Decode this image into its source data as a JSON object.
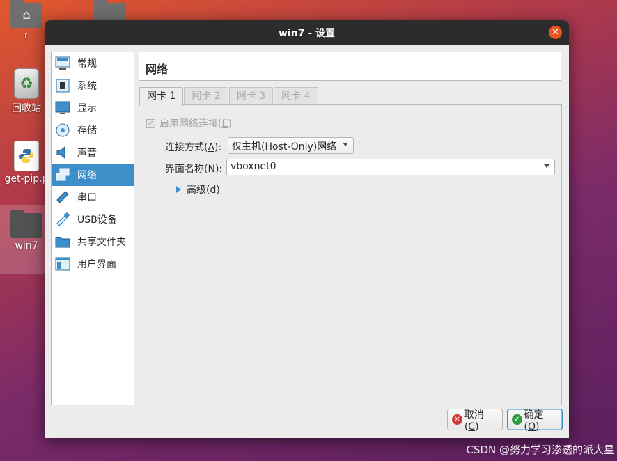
{
  "desktop": {
    "icons": [
      {
        "label": "r"
      },
      {
        "label": ""
      },
      {
        "label": "回收站"
      },
      {
        "label": "get-pip.p"
      },
      {
        "label": "win7"
      }
    ]
  },
  "dialog": {
    "title": "win7 - 设置",
    "close_glyph": "✕",
    "sidebar": [
      {
        "label": "常规",
        "icon": "general-icon"
      },
      {
        "label": "系统",
        "icon": "system-chip-icon"
      },
      {
        "label": "显示",
        "icon": "display-monitor-icon"
      },
      {
        "label": "存储",
        "icon": "storage-disc-icon"
      },
      {
        "label": "声音",
        "icon": "speaker-icon"
      },
      {
        "label": "网络",
        "icon": "network-icon",
        "active": true
      },
      {
        "label": "串口",
        "icon": "serial-port-icon"
      },
      {
        "label": "USB设备",
        "icon": "usb-icon"
      },
      {
        "label": "共享文件夹",
        "icon": "shared-folder-icon"
      },
      {
        "label": "用户界面",
        "icon": "user-interface-icon"
      }
    ],
    "section_title": "网络",
    "tabs": [
      {
        "pre": "网卡 ",
        "key": "1",
        "active": true
      },
      {
        "pre": "网卡 ",
        "key": "2",
        "active": false
      },
      {
        "pre": "网卡 ",
        "key": "3",
        "active": false
      },
      {
        "pre": "网卡 ",
        "key": "4",
        "active": false
      }
    ],
    "enable_checkbox": {
      "pre": "启用网络连接(",
      "key": "E",
      "post": ")",
      "checked": true,
      "disabled": true
    },
    "attach": {
      "label_pre": "连接方式(",
      "label_key": "A",
      "label_post": "):",
      "value": "仅主机(Host-Only)网络"
    },
    "iface": {
      "label_pre": "界面名称(",
      "label_key": "N",
      "label_post": "):",
      "value": "vboxnet0"
    },
    "advanced": {
      "pre": "高级(",
      "key": "d",
      "post": ")"
    },
    "cancel": {
      "pre": "取消(",
      "key": "C",
      "post": ")",
      "icon_glyph": "✕"
    },
    "ok": {
      "pre": "确定(",
      "key": "O",
      "post": ")",
      "icon_glyph": "✓"
    }
  },
  "watermark": "CSDN @努力学习渗透的派大星",
  "colors": {
    "accent": "#3d8ec9",
    "titlebar": "#2c2c2c",
    "close": "#e95420",
    "cancel_icon": "#d43535",
    "ok_icon": "#2e9c3f"
  }
}
